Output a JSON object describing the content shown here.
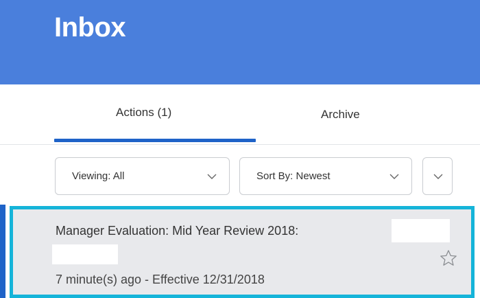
{
  "header": {
    "title": "Inbox"
  },
  "tabs": [
    {
      "label": "Actions (1)",
      "selected": true
    },
    {
      "label": "Archive",
      "selected": false
    }
  ],
  "filters": {
    "viewing_label": "Viewing: All",
    "sort_label": "Sort By: Newest"
  },
  "items": [
    {
      "title": "Manager Evaluation: Mid Year Review 2018:",
      "meta": "7 minute(s) ago - Effective 12/31/2018",
      "starred": false
    }
  ],
  "colors": {
    "header": "#4a7fdc",
    "accent": "#1f63c8",
    "selection_border": "#15b4d9",
    "item_background": "#e8e9ec"
  },
  "icons": [
    "chevron-down-icon",
    "star-icon"
  ]
}
